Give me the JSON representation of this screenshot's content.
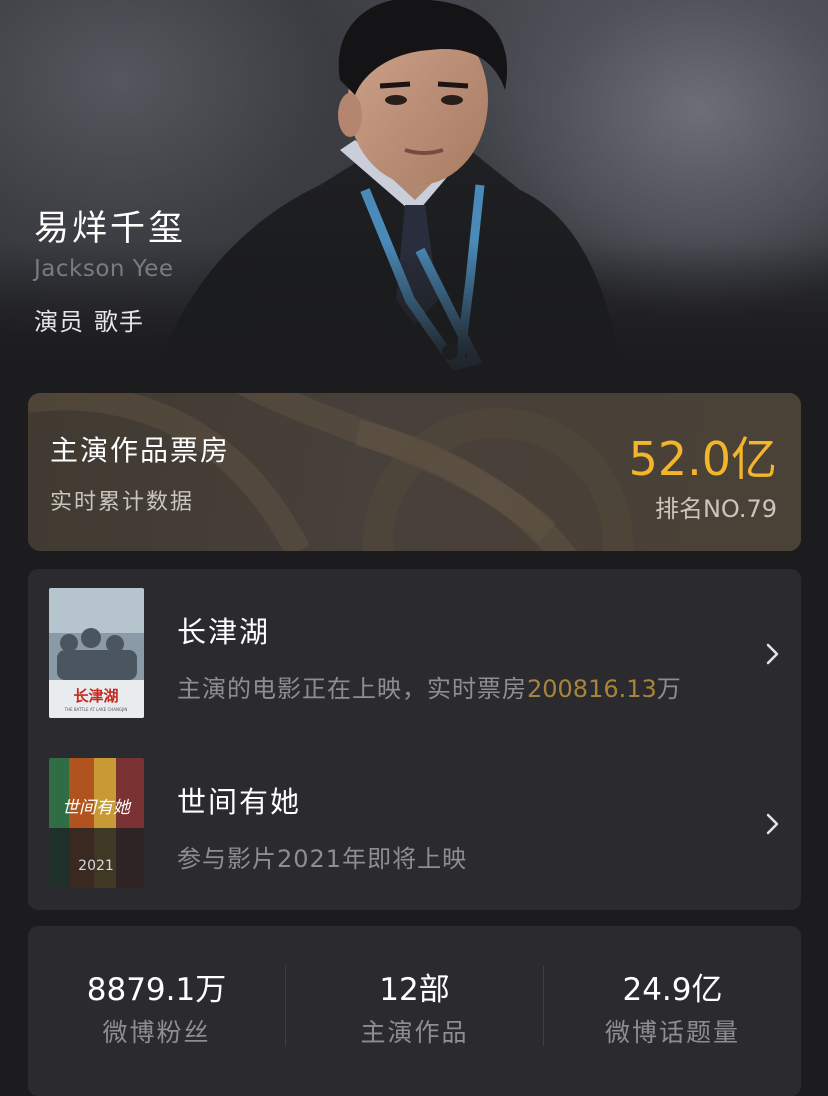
{
  "profile": {
    "name": "易烊千玺",
    "name_en": "Jackson Yee",
    "roles": [
      "演员",
      "歌手"
    ]
  },
  "box_office": {
    "title": "主演作品票房",
    "subtitle": "实时累计数据",
    "value": "52.0亿",
    "rank": "排名NO.79",
    "accent_color": "#f3b52c"
  },
  "movies": [
    {
      "title": "长津湖",
      "desc_prefix": "主演的电影正在上映，实时票房",
      "desc_highlight": "200816.13",
      "desc_suffix": "万",
      "poster_text": "长津湖",
      "poster_caption": "THE BATTLE AT LAKE CHANGJIN"
    },
    {
      "title": "世间有她",
      "desc_prefix": "参与影片2021年即将上映",
      "desc_highlight": "",
      "desc_suffix": "",
      "poster_text": "世间有她",
      "poster_caption": "2021"
    }
  ],
  "stats": [
    {
      "value": "8879.1万",
      "label": "微博粉丝"
    },
    {
      "value": "12部",
      "label": "主演作品"
    },
    {
      "value": "24.9亿",
      "label": "微博话题量"
    }
  ],
  "colors": {
    "background": "#1c1c1e",
    "card": "#2b2b2f",
    "highlight": "#a8843a"
  }
}
